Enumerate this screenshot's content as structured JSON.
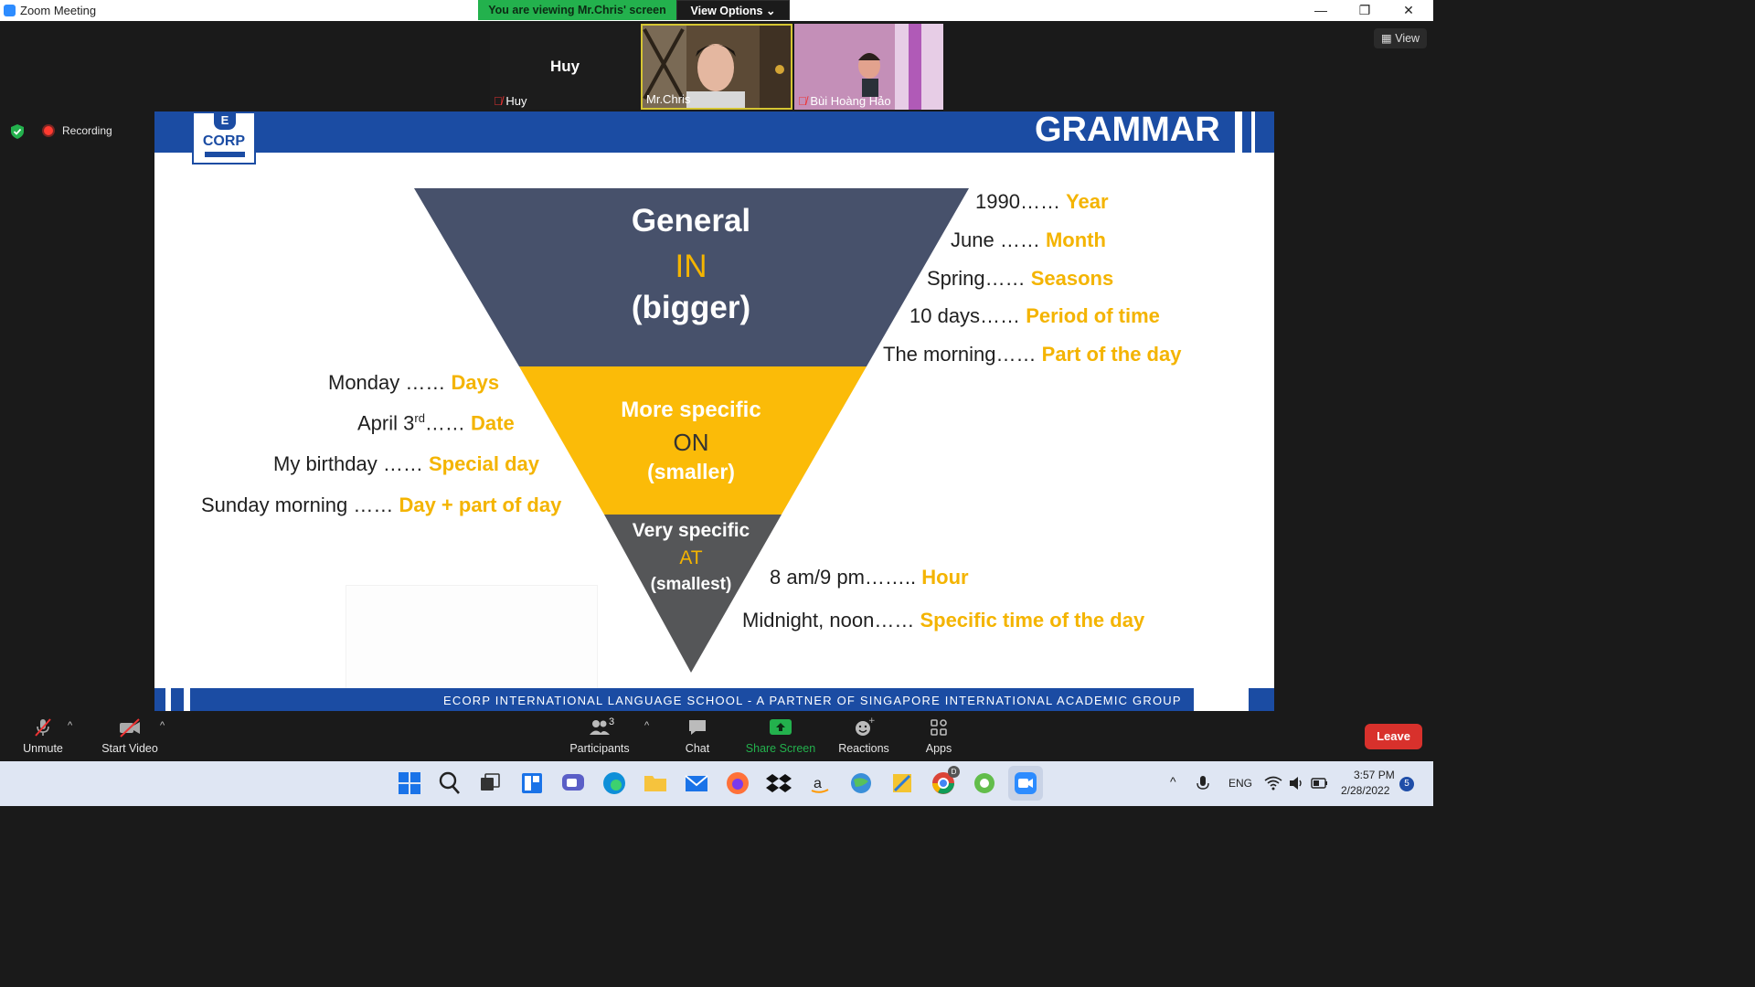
{
  "window": {
    "title": "Zoom Meeting",
    "minimize": "—",
    "restore": "❐",
    "close": "✕"
  },
  "banner": {
    "viewing": "You are viewing Mr.Chris' screen",
    "view_options": "View Options"
  },
  "view_button": {
    "label": "View"
  },
  "participants": [
    {
      "name": "Huy",
      "display": "Huy",
      "muted": true
    },
    {
      "name": "Mr.Chris",
      "muted": false
    },
    {
      "name": "Bùi Hoàng Hảo",
      "muted": true
    }
  ],
  "recording": {
    "label": "Recording"
  },
  "slide": {
    "logo": {
      "name": "CORP"
    },
    "heading": "GRAMMAR",
    "footer": "ECORP INTERNATIONAL LANGUAGE SCHOOL - A PARTNER OF SINGAPORE INTERNATIONAL ACADEMIC GROUP",
    "pyramid": {
      "top": {
        "title": "General",
        "word": "IN",
        "note": "(bigger)"
      },
      "middle": {
        "title": "More specific",
        "word": "ON",
        "note": "(smaller)"
      },
      "bottom": {
        "title": "Very specific",
        "word": "AT",
        "note": "(smallest)"
      }
    },
    "in_examples": [
      {
        "example": "1990……",
        "category": "Year"
      },
      {
        "example": "June ……",
        "category": "Month"
      },
      {
        "example": "Spring……",
        "category": "Seasons"
      },
      {
        "example": "10 days……",
        "category": "Period of time"
      },
      {
        "example": "The morning……",
        "category": "Part of the day"
      }
    ],
    "on_examples": [
      {
        "example": "Monday ……",
        "category": "Days"
      },
      {
        "example_pre": "April 3",
        "example_sup": "rd",
        "example_post": "……",
        "category": "Date"
      },
      {
        "example": "My birthday ……",
        "category": "Special day"
      },
      {
        "example": "Sunday morning ……",
        "category": "Day + part of day"
      }
    ],
    "at_examples": [
      {
        "example": "8 am/9 pm……..",
        "category": "Hour"
      },
      {
        "example": "Midnight, noon……",
        "category": "Specific time of the day"
      }
    ]
  },
  "toolbar": {
    "unmute": "Unmute",
    "start_video": "Start Video",
    "participants": "Participants",
    "participants_count": "3",
    "chat": "Chat",
    "share_screen": "Share Screen",
    "reactions": "Reactions",
    "apps": "Apps",
    "leave": "Leave"
  },
  "taskbar": {
    "language": "ENG",
    "time": "3:57 PM",
    "date": "2/28/2022",
    "notifications": "5",
    "discord_badge": "D"
  },
  "colors": {
    "zoom_blue": "#2d8cff",
    "slide_blue": "#1b4ca3",
    "accent_yellow": "#f4b400",
    "leave_red": "#d8312c",
    "share_green": "#23b14d"
  }
}
